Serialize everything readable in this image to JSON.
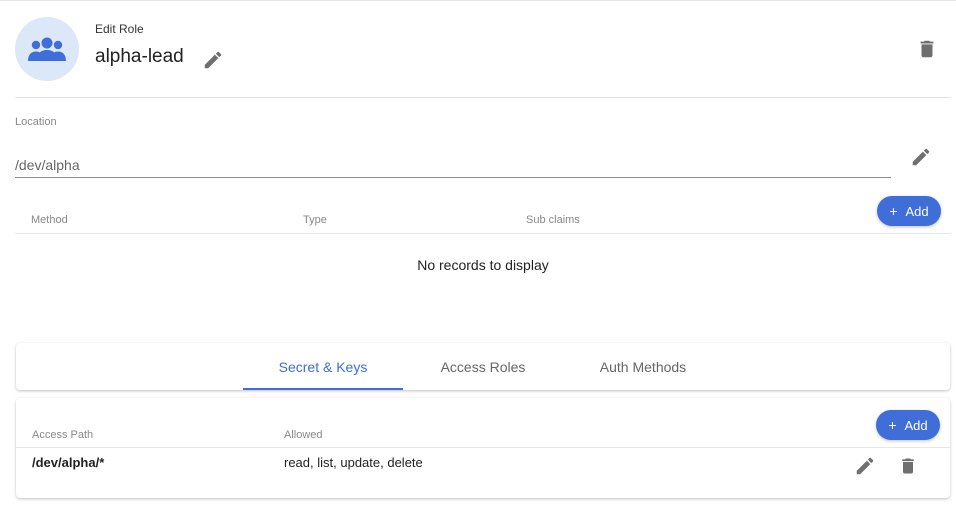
{
  "header": {
    "subtitle": "Edit Role",
    "title": "alpha-lead",
    "avatar_icon": "group-icon",
    "edit_icon": "pencil-icon",
    "delete_icon": "trash-icon"
  },
  "location": {
    "label": "Location",
    "value": "/dev/alpha",
    "edit_icon": "pencil-icon"
  },
  "claims": {
    "columns": [
      "Method",
      "Type",
      "Sub claims"
    ],
    "add_label": "Add",
    "empty_text": "No records to display"
  },
  "tabs": [
    {
      "label": "Secret & Keys",
      "active": true
    },
    {
      "label": "Access Roles",
      "active": false
    },
    {
      "label": "Auth Methods",
      "active": false
    }
  ],
  "access_table": {
    "columns": [
      "Access Path",
      "Allowed"
    ],
    "add_label": "Add",
    "rows": [
      {
        "path": "/dev/alpha/*",
        "allowed": "read, list, update, delete"
      }
    ]
  },
  "colors": {
    "accent": "#3f6ed8",
    "avatar_bg": "#dce8f8",
    "icon_gray": "#6f6f6f"
  }
}
